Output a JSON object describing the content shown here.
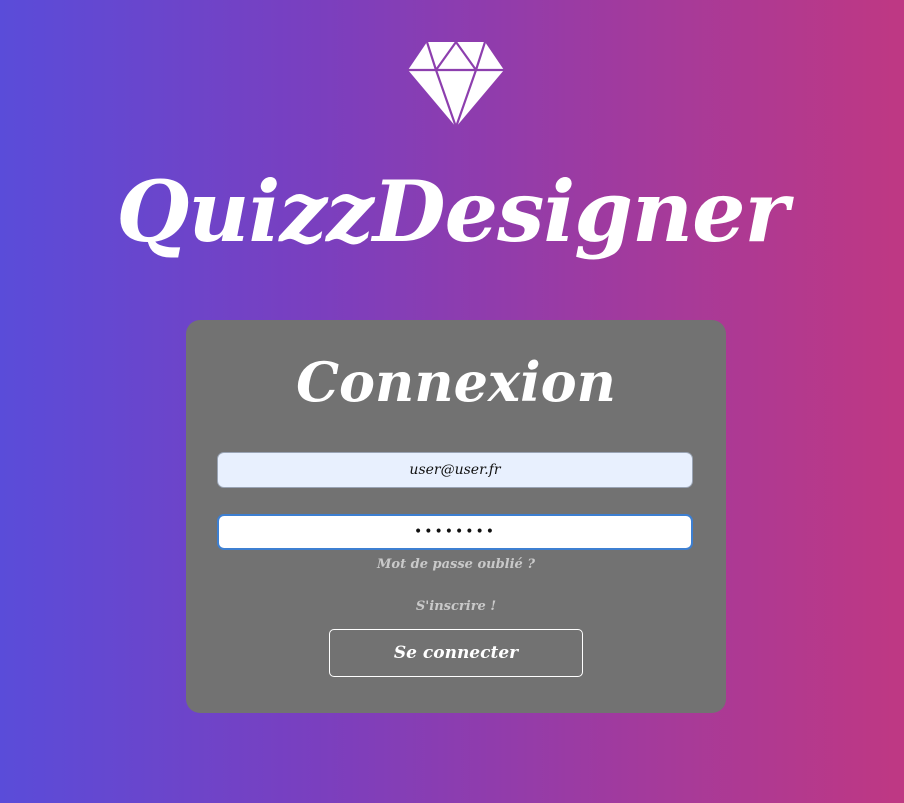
{
  "app": {
    "title": "QuizzDesigner",
    "logo_icon": "diamond-icon"
  },
  "login": {
    "heading": "Connexion",
    "email_value": "user@user.fr",
    "password_value": "........",
    "forgot_password_label": "Mot de passe oublié ?",
    "signup_label": "S'inscrire !",
    "submit_label": "Se connecter"
  },
  "colors": {
    "gradient_start": "#5a4cd9",
    "gradient_end": "#bf3883",
    "card_background": "#727272",
    "focus_border": "#3d7fd1",
    "email_background": "#e8f0fe"
  }
}
